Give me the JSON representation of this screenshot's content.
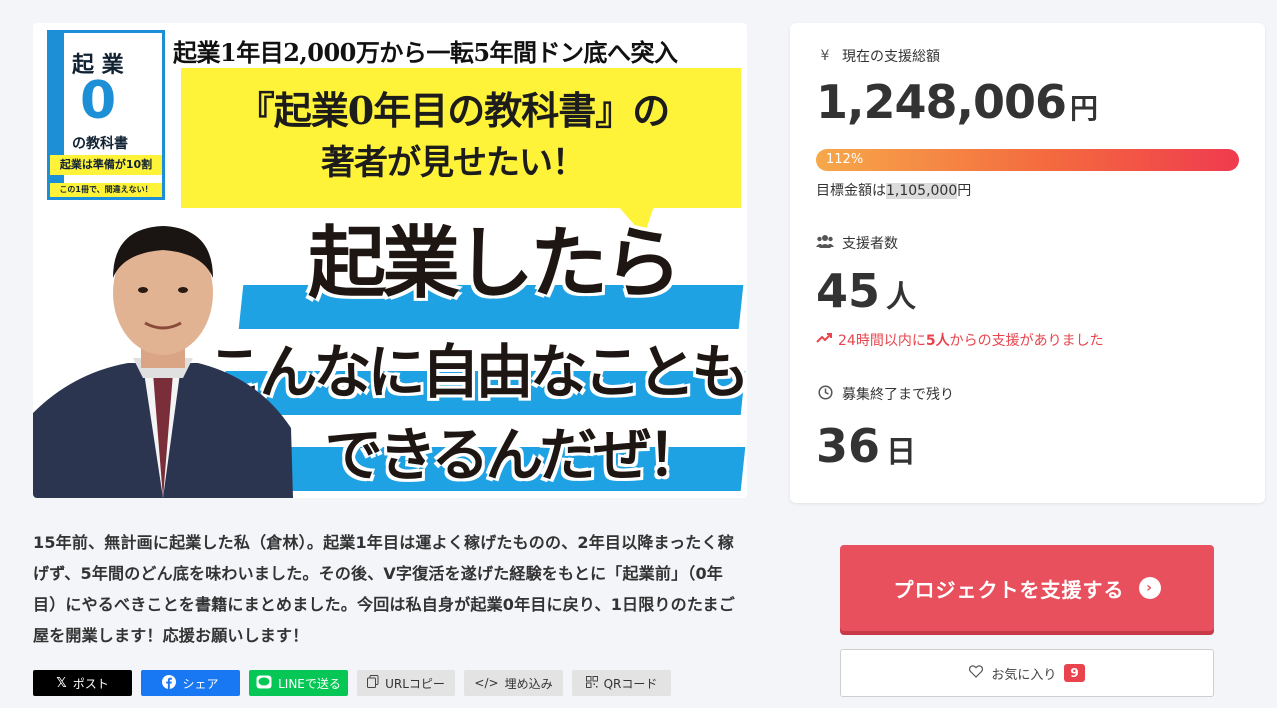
{
  "hero": {
    "top_line": "起業1年目2,000万から一転5年間ドン底へ突入",
    "yellow_line1": "『起業0年目の教科書』の",
    "yellow_line2": "著者が見せたい！",
    "big_line1": "起業したら",
    "big_line2": "こんなに自由なことも",
    "big_line3": "できるんだぜ！",
    "book": {
      "title": "起 業",
      "zero": "0",
      "subtitle": "の教科書",
      "band": "起業は準備が10割",
      "bottom": "この1冊で、間違えない！"
    }
  },
  "stats": {
    "total_label": "現在の支援総額",
    "total_icon": "yen-icon",
    "total_amount": "1,248,006",
    "total_unit": "円",
    "progress_pct": 112,
    "progress_text": "112%",
    "goal_prefix": "目標金額は",
    "goal_amount": "1,105,000",
    "goal_unit": "円",
    "backers_label": "支援者数",
    "backers_count": "45",
    "backers_unit": "人",
    "trend_prefix": "24時間以内に",
    "trend_count": "5人",
    "trend_suffix": "からの支援がありました",
    "remaining_label": "募集終了まで残り",
    "remaining_days": "36",
    "remaining_unit": "日"
  },
  "description": "15年前、無計画に起業した私（倉林）。起業1年目は運よく稼げたものの、2年目以降まったく稼げず、5年間のどん底を味わいました。その後、V字復活を遂げた経験をもとに「起業前」（0年目）にやるべきことを書籍にまとめました。今回は私自身が起業0年目に戻り、1日限りのたまご屋を開業します！応援お願いします！",
  "share": {
    "x": "ポスト",
    "facebook": "シェア",
    "line": "LINEで送る",
    "url": "URLコピー",
    "embed": "埋め込み",
    "qr": "QRコード"
  },
  "cta": {
    "label": "プロジェクトを支援する",
    "arrow": "›"
  },
  "favorite": {
    "label": "お気に入り",
    "count": "9"
  },
  "colors": {
    "accent": "#e9505d",
    "trend": "#e9444d",
    "hero_yellow": "#fff33a",
    "hero_blue": "#1fa2e3"
  }
}
